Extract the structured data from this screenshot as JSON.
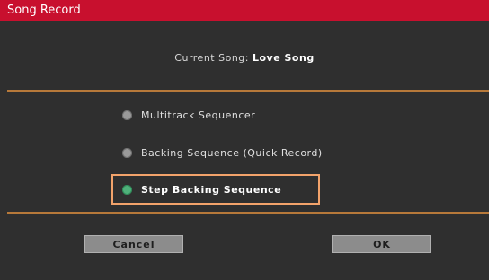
{
  "dialog": {
    "title": "Song Record",
    "current_song_prefix": "Current Song:",
    "current_song_name": "Love Song",
    "options": [
      {
        "label": "Multitrack Sequencer",
        "selected": false
      },
      {
        "label": "Backing Sequence (Quick Record)",
        "selected": false
      },
      {
        "label": "Step Backing Sequence",
        "selected": true
      }
    ],
    "buttons": {
      "cancel": "Cancel",
      "ok": "OK"
    }
  },
  "colors": {
    "titlebar": "#c8102e",
    "background": "#2f2f2f",
    "divider": "#b7793a",
    "highlight": "#f2a36b",
    "radio_selected": "#4fb07a",
    "radio_unselected": "#9a9a9a"
  }
}
